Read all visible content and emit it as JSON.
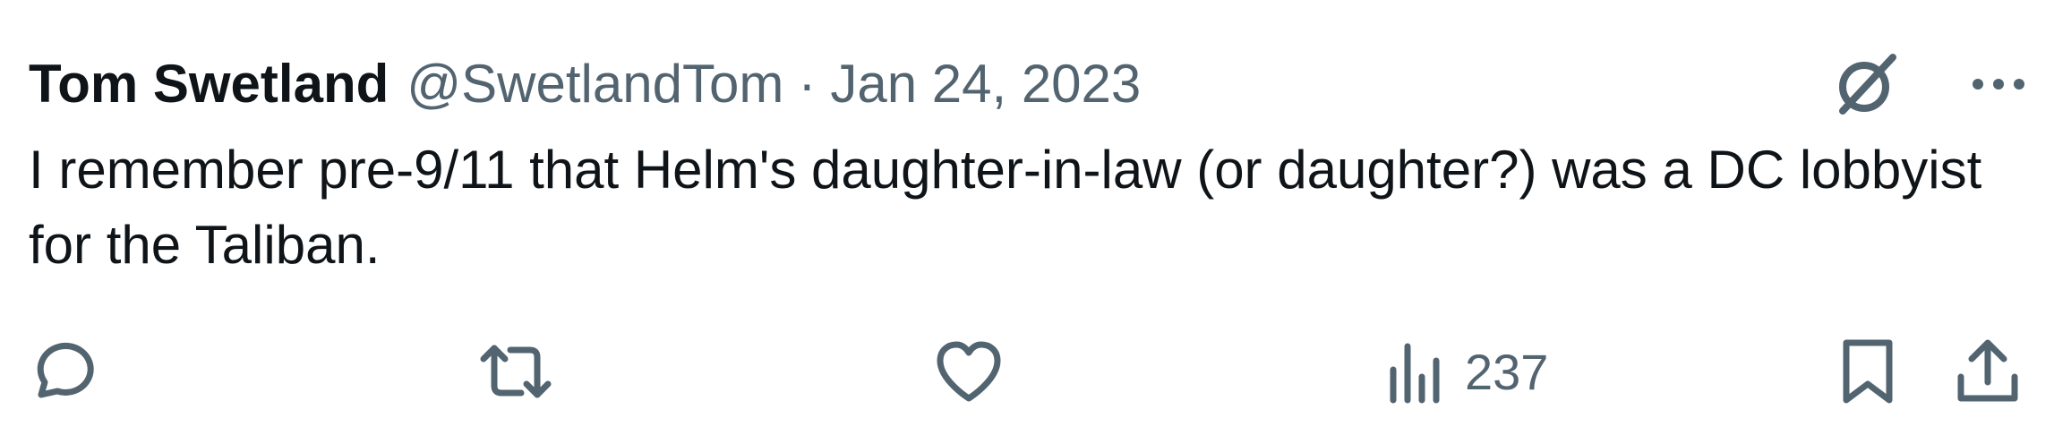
{
  "tweet": {
    "author_name": "Tom Swetland",
    "handle": "@SwetlandTom",
    "separator": "·",
    "date": "Jan 24, 2023",
    "text": "I remember pre-9/11 that Helm's daughter-in-law (or daughter?) was a DC lobbyist for the Taliban."
  },
  "actions": {
    "views_count": "237"
  },
  "icons": {
    "grok": "grok-icon",
    "more": "more-icon",
    "reply": "reply-icon",
    "retweet": "retweet-icon",
    "like": "like-icon",
    "views": "views-icon",
    "bookmark": "bookmark-icon",
    "share": "share-icon"
  },
  "colors": {
    "text": "#0f1419",
    "secondary": "#536471",
    "background": "#ffffff"
  }
}
